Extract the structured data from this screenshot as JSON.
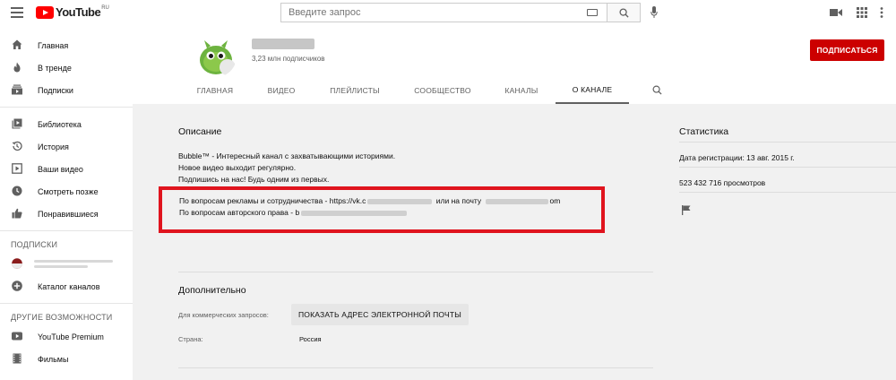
{
  "topbar": {
    "logo_text": "YouTube",
    "logo_region": "RU",
    "search_placeholder": "Введите запрос"
  },
  "sidebar": {
    "primary": [
      {
        "label": "Главная",
        "icon": "home-icon"
      },
      {
        "label": "В тренде",
        "icon": "flame-icon"
      },
      {
        "label": "Подписки",
        "icon": "subscriptions-icon"
      }
    ],
    "library": [
      {
        "label": "Библиотека",
        "icon": "library-icon"
      },
      {
        "label": "История",
        "icon": "history-icon"
      },
      {
        "label": "Ваши видео",
        "icon": "your-videos-icon"
      },
      {
        "label": "Смотреть позже",
        "icon": "clock-icon"
      },
      {
        "label": "Понравившиеся",
        "icon": "thumb-up-icon"
      }
    ],
    "subscriptions_heading": "ПОДПИСКИ",
    "catalog_label": "Каталог каналов",
    "more_heading": "ДРУГИЕ ВОЗМОЖНОСТИ",
    "more": [
      {
        "label": "YouTube Premium",
        "icon": "youtube-icon"
      },
      {
        "label": "Фильмы",
        "icon": "film-icon"
      }
    ]
  },
  "channel": {
    "subscribers": "3,23 млн подписчиков",
    "subscribe_label": "ПОДПИСАТЬСЯ",
    "tabs": [
      "ГЛАВНАЯ",
      "ВИДЕО",
      "ПЛЕЙЛИСТЫ",
      "СООБЩЕСТВО",
      "КАНАЛЫ",
      "О КАНАЛЕ"
    ],
    "active_tab": "О КАНАЛЕ"
  },
  "about": {
    "description_title": "Описание",
    "description_lines": [
      "Bubble™ - Интересный канал с захватывающими историями.",
      "Новое видео выходит регулярно.",
      "Подпишись на нас! Будь одним из первых."
    ],
    "ads_prefix": "По вопросам рекламы и сотрудничества - https://vk.c",
    "ads_middle": "или на почту",
    "ads_suffix": "om",
    "copyright_prefix": "По вопросам авторского права - b",
    "additional_title": "Дополнительно",
    "business_label": "Для коммерческих запросов:",
    "show_email_label": "ПОКАЗАТЬ АДРЕС ЭЛЕКТРОННОЙ ПОЧТЫ",
    "country_label": "Страна:",
    "country_value": "Россия"
  },
  "stats": {
    "title": "Статистика",
    "registered": "Дата регистрации: 13 авг. 2015 г.",
    "views": "523 432 716 просмотров"
  },
  "colors": {
    "brand_red": "#ff0000",
    "subscribe_red": "#cc0000",
    "highlight_red": "#e0141e"
  }
}
